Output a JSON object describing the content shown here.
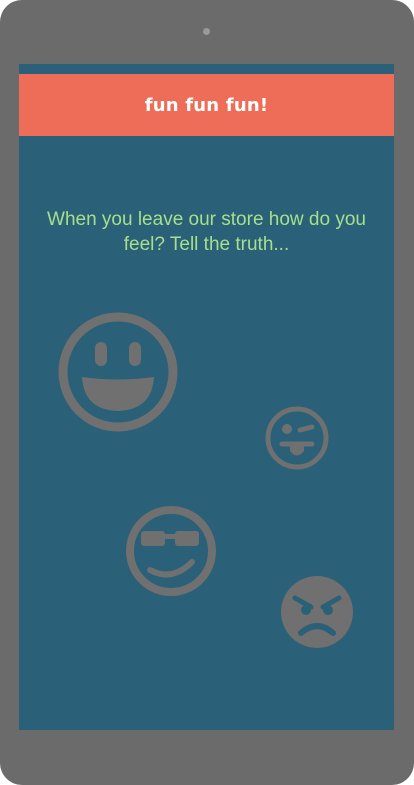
{
  "app": {
    "title": "fun fun fun!"
  },
  "main": {
    "question": "When you leave our store how do you feel? Tell the truth..."
  },
  "faces": [
    {
      "name": "happy-face",
      "icon": "grinning-face-icon"
    },
    {
      "name": "tongue-face",
      "icon": "tongue-out-face-icon"
    },
    {
      "name": "cool-face",
      "icon": "sunglasses-face-icon"
    },
    {
      "name": "angry-face",
      "icon": "angry-face-icon"
    }
  ],
  "colors": {
    "device": "#6b6b6b",
    "screen": "#2a6078",
    "header": "#ee6d58",
    "question_text": "#a7df8c",
    "emoji": "#707070"
  }
}
